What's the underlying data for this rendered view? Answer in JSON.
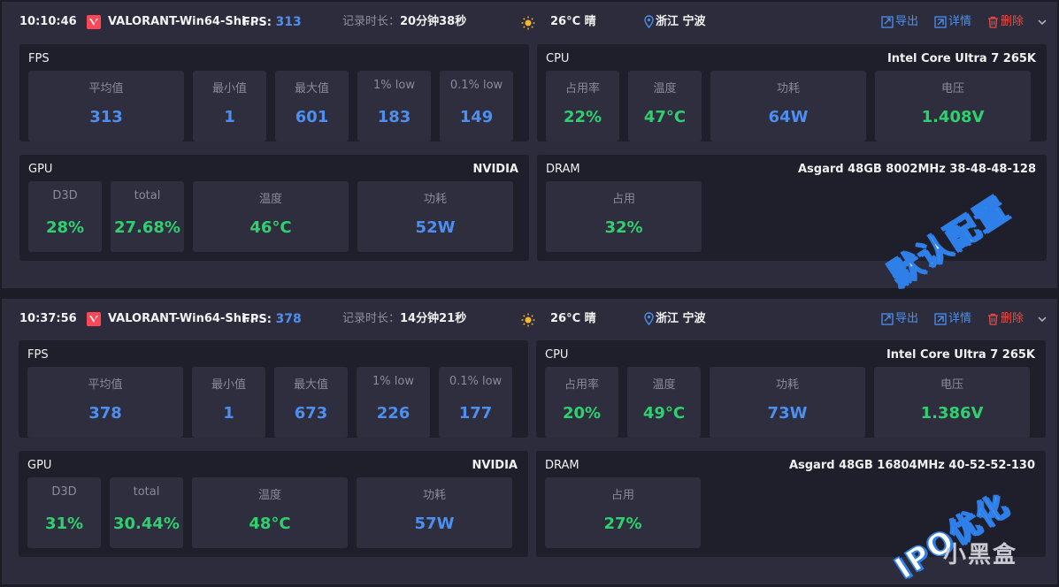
{
  "records": [
    {
      "header": {
        "time": "10:10:46",
        "game": "VALORANT-Win64-Shi...",
        "fps_label": "FPS:",
        "fps_value": "313",
        "duration_label": "记录时长：",
        "duration_value": "20分钟38秒",
        "weather": "26°C 晴",
        "location": "浙江 宁波",
        "export": "导出",
        "detail": "详情",
        "delete": "删除"
      },
      "fps": {
        "title": "FPS",
        "tiles": [
          {
            "label": "平均值",
            "value": "313"
          },
          {
            "label": "最小值",
            "value": "1"
          },
          {
            "label": "最大值",
            "value": "601"
          },
          {
            "label": "1% low",
            "value": "183"
          },
          {
            "label": "0.1% low",
            "value": "149"
          }
        ]
      },
      "cpu": {
        "title": "CPU",
        "model": "Intel Core Ultra 7 265K",
        "tiles": [
          {
            "label": "占用率",
            "value": "22%"
          },
          {
            "label": "温度",
            "value": "47°C"
          },
          {
            "label": "功耗",
            "value": "64W"
          },
          {
            "label": "电压",
            "value": "1.408V"
          }
        ]
      },
      "gpu": {
        "title": "GPU",
        "model": "NVIDIA",
        "tiles": [
          {
            "label": "D3D",
            "value": "28%"
          },
          {
            "label": "total",
            "value": "27.68%"
          },
          {
            "label": "温度",
            "value": "46°C"
          },
          {
            "label": "功耗",
            "value": "52W"
          }
        ]
      },
      "dram": {
        "title": "DRAM",
        "model": "Asgard 48GB 8002MHz 38-48-48-128",
        "tiles": [
          {
            "label": "占用",
            "value": "32%"
          }
        ]
      },
      "stamp": "默认配置"
    },
    {
      "header": {
        "time": "10:37:56",
        "game": "VALORANT-Win64-Shi...",
        "fps_label": "FPS:",
        "fps_value": "378",
        "duration_label": "记录时长：",
        "duration_value": "14分钟21秒",
        "weather": "26°C 晴",
        "location": "浙江 宁波",
        "export": "导出",
        "detail": "详情",
        "delete": "删除"
      },
      "fps": {
        "title": "FPS",
        "tiles": [
          {
            "label": "平均值",
            "value": "378"
          },
          {
            "label": "最小值",
            "value": "1"
          },
          {
            "label": "最大值",
            "value": "673"
          },
          {
            "label": "1% low",
            "value": "226"
          },
          {
            "label": "0.1% low",
            "value": "177"
          }
        ]
      },
      "cpu": {
        "title": "CPU",
        "model": "Intel Core Ultra 7 265K",
        "tiles": [
          {
            "label": "占用率",
            "value": "20%"
          },
          {
            "label": "温度",
            "value": "49°C"
          },
          {
            "label": "功耗",
            "value": "73W"
          },
          {
            "label": "电压",
            "value": "1.386V"
          }
        ]
      },
      "gpu": {
        "title": "GPU",
        "model": "NVIDIA",
        "tiles": [
          {
            "label": "D3D",
            "value": "31%"
          },
          {
            "label": "total",
            "value": "30.44%"
          },
          {
            "label": "温度",
            "value": "48°C"
          },
          {
            "label": "功耗",
            "value": "57W"
          }
        ]
      },
      "dram": {
        "title": "DRAM",
        "model": "Asgard 48GB 16804MHz 40-52-52-130",
        "tiles": [
          {
            "label": "占用",
            "value": "27%"
          }
        ]
      },
      "stamp": "IPO优化"
    }
  ],
  "watermark": "小黑盒",
  "colors": {
    "accent_blue": "#4d8ff0",
    "value_green": "#2fd06f",
    "delete_red": "#e0504a",
    "card_bg": "#2c2c3c",
    "panel_bg": "#1f1f2b",
    "tile_bg": "#2e2e3e"
  },
  "icons": [
    "valorant-icon",
    "sun-icon",
    "location-pin-icon",
    "export-icon",
    "detail-icon",
    "trash-icon",
    "chevron-down-icon"
  ]
}
